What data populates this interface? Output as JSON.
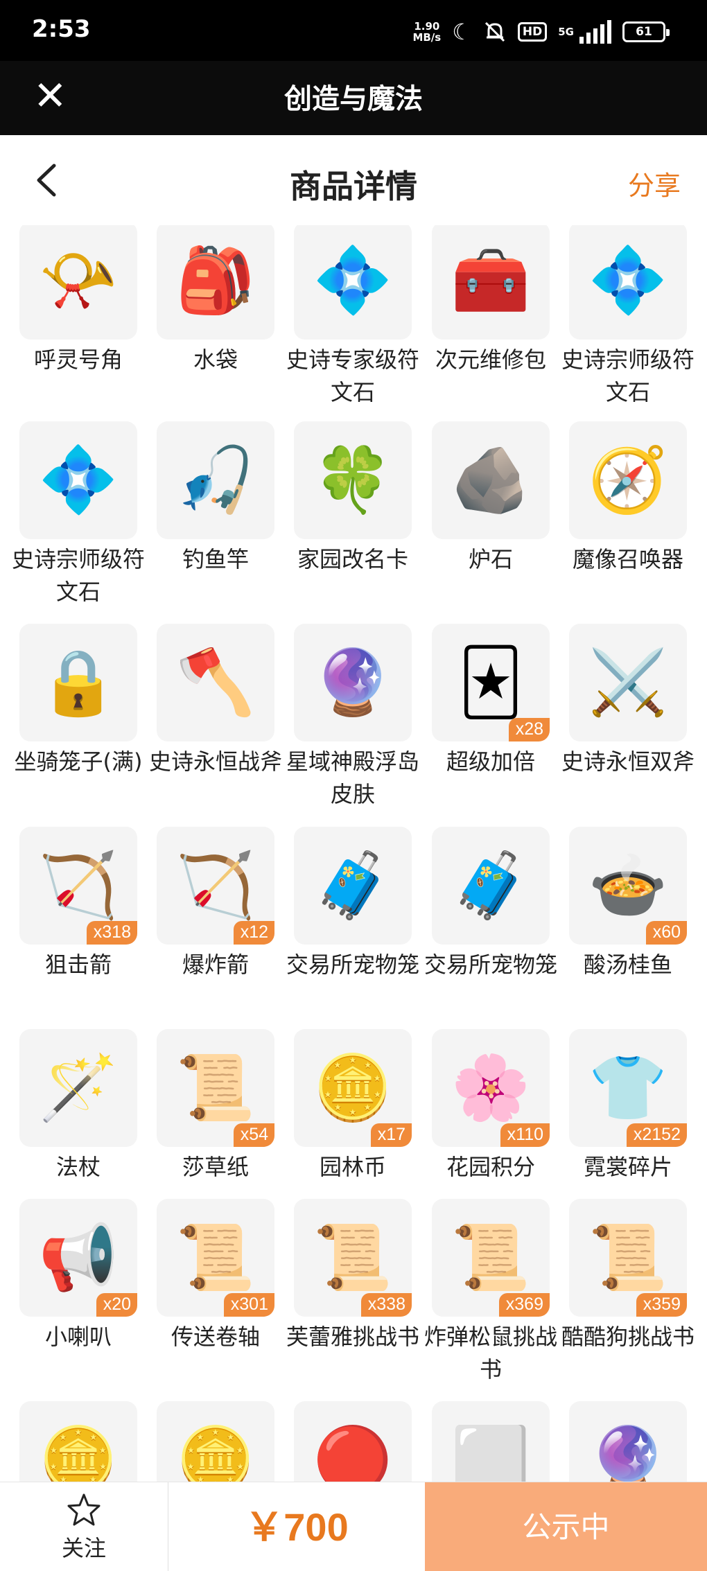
{
  "status_bar": {
    "time": "2:53",
    "speed_value": "1.90",
    "speed_unit": "MB/s",
    "hd": "HD",
    "network": "5G",
    "battery": "61"
  },
  "app_bar": {
    "title": "创造与魔法"
  },
  "header": {
    "title": "商品详情",
    "share": "分享"
  },
  "items": [
    {
      "name": "呼灵号角",
      "icon": "horn",
      "count": ""
    },
    {
      "name": "水袋",
      "icon": "water-bag",
      "count": ""
    },
    {
      "name": "史诗专家级符文石",
      "icon": "rune-stone",
      "count": ""
    },
    {
      "name": "次元维修包",
      "icon": "repair-kit",
      "count": ""
    },
    {
      "name": "史诗宗师级符文石",
      "icon": "rune-stone",
      "count": ""
    },
    {
      "name": "史诗宗师级符文石",
      "icon": "rune-stone",
      "count": ""
    },
    {
      "name": "钓鱼竿",
      "icon": "fishing-rod",
      "count": ""
    },
    {
      "name": "家园改名卡",
      "icon": "rename-card",
      "count": ""
    },
    {
      "name": "炉石",
      "icon": "hearthstone",
      "count": ""
    },
    {
      "name": "魔像召唤器",
      "icon": "golem-summoner",
      "count": ""
    },
    {
      "name": "坐骑笼子(满)",
      "icon": "mount-cage",
      "count": ""
    },
    {
      "name": "史诗永恒战斧",
      "icon": "battle-axe",
      "count": ""
    },
    {
      "name": "星域神殿浮岛皮肤",
      "icon": "floating-island",
      "count": ""
    },
    {
      "name": "超级加倍",
      "icon": "double-card",
      "count": "x28"
    },
    {
      "name": "史诗永恒双斧",
      "icon": "twin-axes",
      "count": ""
    },
    {
      "name": "狙击箭",
      "icon": "sniper-arrow",
      "count": "x318"
    },
    {
      "name": "爆炸箭",
      "icon": "explosive-arrow",
      "count": "x12"
    },
    {
      "name": "交易所宠物笼",
      "icon": "pet-cage",
      "count": ""
    },
    {
      "name": "交易所宠物笼",
      "icon": "pet-cage",
      "count": ""
    },
    {
      "name": "酸汤桂鱼",
      "icon": "fish-dish",
      "count": "x60"
    },
    {
      "name": "法杖",
      "icon": "staff",
      "count": ""
    },
    {
      "name": "莎草纸",
      "icon": "papyrus",
      "count": "x54"
    },
    {
      "name": "园林币",
      "icon": "garden-coin",
      "count": "x17"
    },
    {
      "name": "花园积分",
      "icon": "flower-token",
      "count": "x110"
    },
    {
      "name": "霓裳碎片",
      "icon": "shirt-fragment",
      "count": "x2152"
    },
    {
      "name": "小喇叭",
      "icon": "megaphone",
      "count": "x20"
    },
    {
      "name": "传送卷轴",
      "icon": "teleport-scroll",
      "count": "x301"
    },
    {
      "name": "芙蕾雅挑战书",
      "icon": "wanted-scroll",
      "count": "x338"
    },
    {
      "name": "炸弹松鼠挑战书",
      "icon": "wanted-scroll",
      "count": "x369"
    },
    {
      "name": "酷酷狗挑战书",
      "icon": "wanted-scroll",
      "count": "x359"
    },
    {
      "name": "",
      "icon": "gold-coin",
      "count": ""
    },
    {
      "name": "",
      "icon": "bow-coin",
      "count": ""
    },
    {
      "name": "",
      "icon": "red-gem-coin",
      "count": ""
    },
    {
      "name": "",
      "icon": "white-item",
      "count": ""
    },
    {
      "name": "",
      "icon": "purple-crystal",
      "count": ""
    }
  ],
  "bottom_bar": {
    "follow_label": "关注",
    "price": "￥700",
    "status_button": "公示中"
  },
  "colors": {
    "accent": "#e8791f",
    "button": "#f9ab7a",
    "badge": "#f08a3a"
  }
}
